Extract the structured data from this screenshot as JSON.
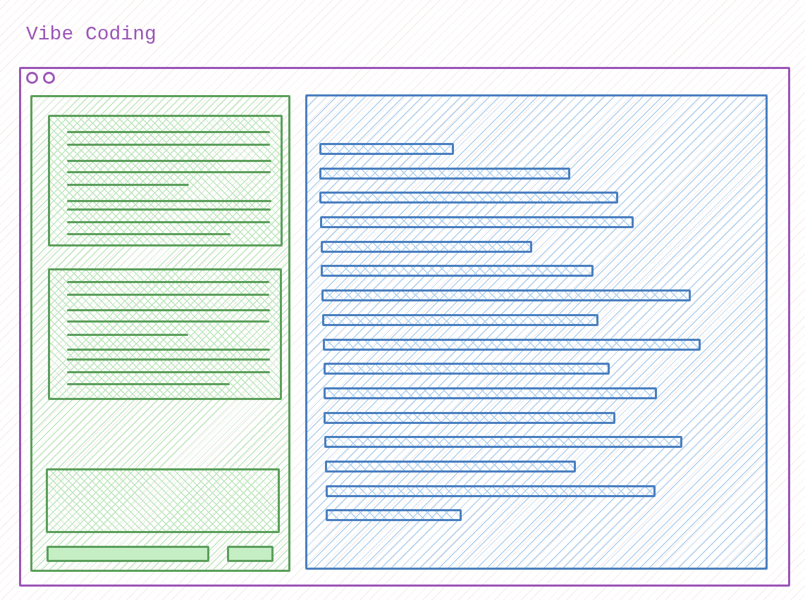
{
  "title": "Vibe Coding"
}
